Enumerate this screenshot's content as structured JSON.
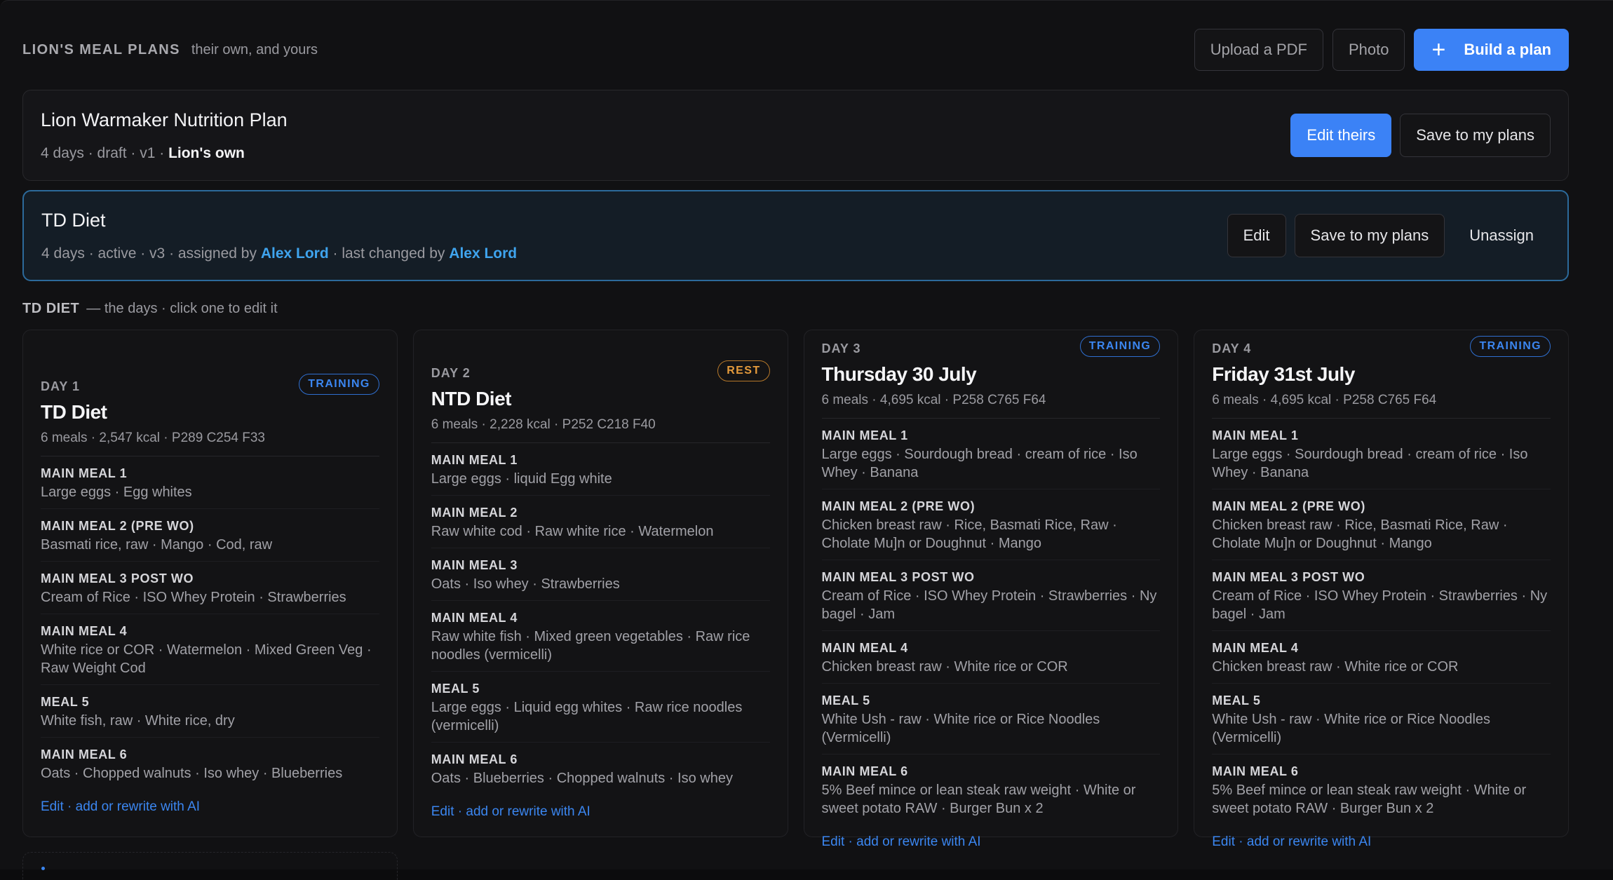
{
  "header": {
    "title": "LION'S MEAL PLANS",
    "subtitle": "their own, and yours",
    "upload_label": "Upload a PDF",
    "photo_label": "Photo",
    "build_label": "Build a plan",
    "build_icon": "plus-icon"
  },
  "plans": [
    {
      "title": "Lion Warmaker Nutrition Plan",
      "meta": "4 days · draft · v1 · ",
      "owner": "Lion's own",
      "actions": {
        "edit": "Edit theirs",
        "save": "Save to my plans"
      }
    },
    {
      "title": "TD Diet",
      "meta_prefix": "4 days · active · v3 · assigned by ",
      "assigned_by": "Alex Lord",
      "meta_mid": " · last changed by ",
      "changed_by": "Alex Lord",
      "actions": {
        "edit": "Edit",
        "save": "Save to my plans",
        "unassign": "Unassign"
      }
    }
  ],
  "section": {
    "title": "TD DIET",
    "hint": "— the days · click one to edit it"
  },
  "days": [
    {
      "label": "DAY 1",
      "badge": "TRAINING",
      "title": "TD Diet",
      "stats": "6 meals · 2,547 kcal · P289 C254 F33",
      "meals": [
        {
          "name": "MAIN MEAL 1",
          "items": "Large eggs · Egg whites"
        },
        {
          "name": "MAIN MEAL 2 (PRE WO)",
          "items": "Basmati rice, raw · Mango · Cod, raw"
        },
        {
          "name": "MAIN MEAL 3 POST WO",
          "items": "Cream of Rice · ISO Whey Protein · Strawberries"
        },
        {
          "name": "MAIN MEAL 4",
          "items": "White rice or COR · Watermelon · Mixed Green Veg · Raw Weight Cod"
        },
        {
          "name": "MEAL 5",
          "items": "White fish, raw · White rice, dry"
        },
        {
          "name": "MAIN MEAL 6",
          "items": "Oats · Chopped walnuts · Iso whey · Blueberries"
        }
      ],
      "link_edit": "Edit",
      "link_sep": " · ",
      "link_ai": "add or rewrite with AI"
    },
    {
      "label": "DAY 2",
      "badge": "REST",
      "title": "NTD Diet",
      "stats": "6 meals · 2,228 kcal · P252 C218 F40",
      "meals": [
        {
          "name": "MAIN MEAL 1",
          "items": "Large eggs · liquid Egg white"
        },
        {
          "name": "MAIN MEAL 2",
          "items": "Raw white cod · Raw white rice · Watermelon"
        },
        {
          "name": "MAIN MEAL 3",
          "items": "Oats · Iso whey · Strawberries"
        },
        {
          "name": "MAIN MEAL 4",
          "items": "Raw white fish · Mixed green vegetables · Raw rice noodles (vermicelli)"
        },
        {
          "name": "MEAL 5",
          "items": "Large eggs · Liquid egg whites · Raw rice noodles (vermicelli)"
        },
        {
          "name": "MAIN MEAL 6",
          "items": "Oats · Blueberries · Chopped walnuts · Iso whey"
        }
      ],
      "link_edit": "Edit",
      "link_sep": " · ",
      "link_ai": "add or rewrite with AI"
    },
    {
      "label": "DAY 3",
      "badge": "TRAINING",
      "title": "Thursday 30 July",
      "stats": "6 meals · 4,695 kcal · P258 C765 F64",
      "meals": [
        {
          "name": "MAIN MEAL 1",
          "items": "Large eggs · Sourdough bread · cream of rice · Iso Whey · Banana"
        },
        {
          "name": "MAIN MEAL 2 (PRE WO)",
          "items": "Chicken breast raw · Rice, Basmati Rice, Raw · Cholate Mu]n or Doughnut · Mango"
        },
        {
          "name": "MAIN MEAL 3 POST WO",
          "items": "Cream of Rice · ISO Whey Protein · Strawberries · Ny bagel · Jam"
        },
        {
          "name": "MAIN MEAL 4",
          "items": "Chicken breast raw · White rice or COR"
        },
        {
          "name": "MEAL 5",
          "items": "White Ush - raw · White rice or Rice Noodles (Vermicelli)"
        },
        {
          "name": "MAIN MEAL 6",
          "items": "5% Beef mince or lean steak raw weight · White or sweet potato RAW · Burger Bun x 2"
        }
      ],
      "link_edit": "Edit",
      "link_sep": " · ",
      "link_ai": "add or rewrite with AI"
    },
    {
      "label": "DAY 4",
      "badge": "TRAINING",
      "title": "Friday 31st July",
      "stats": "6 meals · 4,695 kcal · P258 C765 F64",
      "meals": [
        {
          "name": "MAIN MEAL 1",
          "items": "Large eggs · Sourdough bread · cream of rice · Iso Whey · Banana"
        },
        {
          "name": "MAIN MEAL 2 (PRE WO)",
          "items": "Chicken breast raw · Rice, Basmati Rice, Raw · Cholate Mu]n or Doughnut · Mango"
        },
        {
          "name": "MAIN MEAL 3 POST WO",
          "items": "Cream of Rice · ISO Whey Protein · Strawberries · Ny bagel · Jam"
        },
        {
          "name": "MAIN MEAL 4",
          "items": "Chicken breast raw · White rice or COR"
        },
        {
          "name": "MEAL 5",
          "items": "White Ush - raw · White rice or Rice Noodles (Vermicelli)"
        },
        {
          "name": "MAIN MEAL 6",
          "items": "5% Beef mince or lean steak raw weight · White or sweet potato RAW · Burger Bun x 2"
        }
      ],
      "link_edit": "Edit",
      "link_sep": " · ",
      "link_ai": "add or rewrite with AI"
    }
  ],
  "colors": {
    "accent": "#3b82f6",
    "link": "#3fa4ee",
    "rest": "#e59b3c",
    "active_border": "#2c6a9b"
  }
}
